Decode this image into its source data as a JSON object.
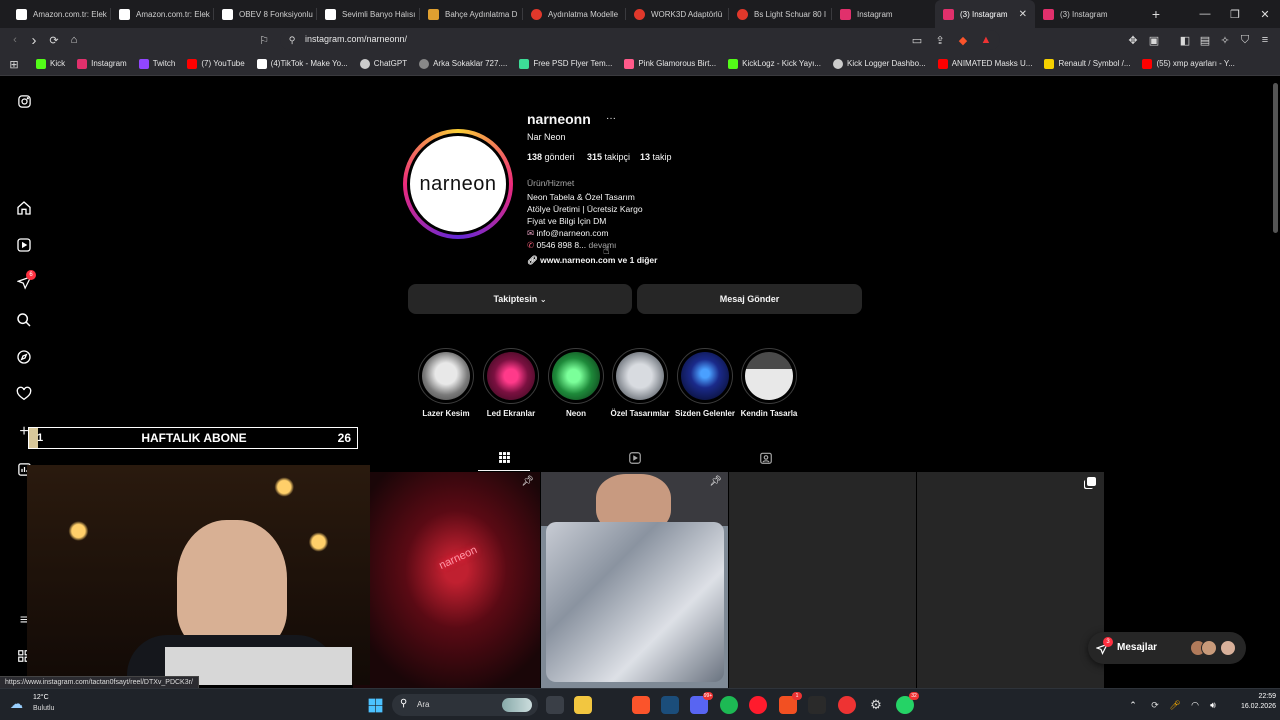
{
  "browser": {
    "tabs": [
      {
        "title": "Amazon.com.tr: Elek",
        "color": "#ffffff"
      },
      {
        "title": "Amazon.com.tr: Elek",
        "color": "#ffffff"
      },
      {
        "title": "OBEV 8 Fonksiyonlu",
        "color": "#ffffff"
      },
      {
        "title": "Sevimli Banyo Halısı",
        "color": "#ffffff"
      },
      {
        "title": "Bahçe Aydınlatma D",
        "color": "#e0a030"
      },
      {
        "title": "Aydınlatma Modelle",
        "color": "#e0382b"
      },
      {
        "title": "WORK3D Adaptörlü",
        "color": "#e0382b"
      },
      {
        "title": "Bs Light Schuar 80 I",
        "color": "#e0382b"
      },
      {
        "title": "Instagram",
        "color": "#e1306c"
      },
      {
        "title": "(3) Instagram",
        "color": "#e1306c",
        "active": true
      },
      {
        "title": "(3) Instagram",
        "color": "#e1306c"
      }
    ],
    "new_tab": "+",
    "url": "instagram.com/narneonn/",
    "bookmarks": [
      {
        "label": "Kick",
        "color": "#53fc18"
      },
      {
        "label": "Instagram",
        "color": "#e1306c"
      },
      {
        "label": "Twitch",
        "color": "#9146ff"
      },
      {
        "label": "(7) YouTube",
        "color": "#ff0000"
      },
      {
        "label": "(4)TikTok - Make Yo...",
        "color": "#ffffff"
      },
      {
        "label": "ChatGPT",
        "color": "#cccccc"
      },
      {
        "label": "Arka Sokaklar 727....",
        "color": "#888888"
      },
      {
        "label": "Free PSD Flyer Tem...",
        "color": "#3ddc97"
      },
      {
        "label": "Pink Glamorous Birt...",
        "color": "#ff5a8a"
      },
      {
        "label": "KickLogz - Kick Yayı...",
        "color": "#53fc18"
      },
      {
        "label": "Kick Logger Dashbo...",
        "color": "#cccccc"
      },
      {
        "label": "ANIMATED Masks U...",
        "color": "#ff0000"
      },
      {
        "label": "Renault / Symbol /...",
        "color": "#f5d000"
      },
      {
        "label": "(55) xmp ayarları - Y...",
        "color": "#ff0000"
      }
    ],
    "status_url": "https://www.instagram.com/tactan0fsayt/reel/DTXv_PDCK3r/"
  },
  "sidebar": {
    "notifications_badge": "6"
  },
  "profile": {
    "username": "narneonn",
    "more": "···",
    "display_name": "Nar Neon",
    "avatar_text": "narneon",
    "posts_count": "138",
    "posts_label": "gönderi",
    "followers_count": "315",
    "followers_label": "takipçi",
    "following_count": "13",
    "following_label": "takip",
    "category": "Ürün/Hizmet",
    "bio": [
      "Neon Tabela & Özel Tasarım",
      "Atölye Üretimi | Ücretsiz Kargo",
      "Fiyat ve Bilgi İçin DM"
    ],
    "email": "info@narneon.com",
    "phone": "0546 898 8...",
    "more_link": "devamı",
    "website": "www.narneon.com ve 1 diğer",
    "follow_button": "Takiptesin",
    "message_button": "Mesaj Gönder"
  },
  "highlights": [
    {
      "label": "Lazer Kesim"
    },
    {
      "label": "Led Ekranlar"
    },
    {
      "label": "Neon"
    },
    {
      "label": "Özel Tasarımlar"
    },
    {
      "label": "Sizden Gelenler"
    },
    {
      "label": "Kendin Tasarla"
    }
  ],
  "overlay": {
    "banner_left": "1",
    "banner_title": "HAFTALIK ABONE",
    "banner_count": "26",
    "post_label": "narneon"
  },
  "messages": {
    "label": "Mesajlar",
    "badge": "3"
  },
  "taskbar": {
    "temp": "12°C",
    "weather": "Bulutlu",
    "search": "Ara",
    "time": "22:59",
    "date": "16.02.2026",
    "badges": [
      "99+",
      "1",
      "32"
    ]
  }
}
